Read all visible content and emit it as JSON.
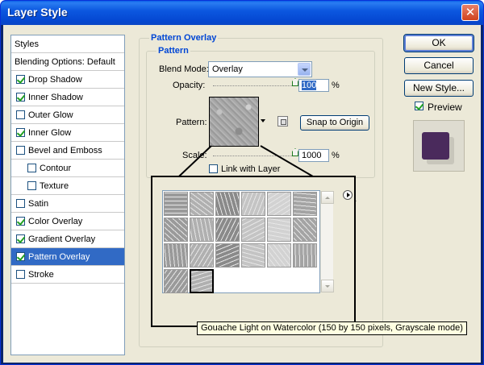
{
  "window": {
    "title": "Layer Style",
    "close_glyph": "✕"
  },
  "styles_panel": {
    "header": "Styles",
    "blending": "Blending Options: Default",
    "items": [
      {
        "label": "Drop Shadow",
        "checked": true
      },
      {
        "label": "Inner Shadow",
        "checked": true
      },
      {
        "label": "Outer Glow",
        "checked": false
      },
      {
        "label": "Inner Glow",
        "checked": true
      },
      {
        "label": "Bevel and Emboss",
        "checked": false
      },
      {
        "label": "Contour",
        "checked": false
      },
      {
        "label": "Texture",
        "checked": false
      },
      {
        "label": "Satin",
        "checked": false
      },
      {
        "label": "Color Overlay",
        "checked": true
      },
      {
        "label": "Gradient Overlay",
        "checked": true
      },
      {
        "label": "Pattern Overlay",
        "checked": true,
        "selected": true
      },
      {
        "label": "Stroke",
        "checked": false
      }
    ]
  },
  "pattern_overlay": {
    "group_title": "Pattern Overlay",
    "subgroup_title": "Pattern",
    "blend_mode_label": "Blend Mode:",
    "blend_mode_value": "Overlay",
    "opacity_label": "Opacity:",
    "opacity_value": "100",
    "opacity_unit": "%",
    "opacity_level": 1.0,
    "pattern_label": "Pattern:",
    "snap_button": "Snap to Origin",
    "scale_label": "Scale:",
    "scale_value": "1000",
    "scale_unit": "%",
    "scale_level": 1.0,
    "link_label": "Link with Layer",
    "link_checked": false
  },
  "buttons": {
    "ok": "OK",
    "cancel": "Cancel",
    "new_style": "New Style...",
    "preview_label": "Preview",
    "preview_checked": true
  },
  "preview_colors": {
    "swatch": "#4a2a5c"
  },
  "pattern_picker": {
    "tooltip": "Gouache Light on Watercolor (150 by 150 pixels, Grayscale mode)",
    "selected_index": 19,
    "pattern_count": 20
  }
}
